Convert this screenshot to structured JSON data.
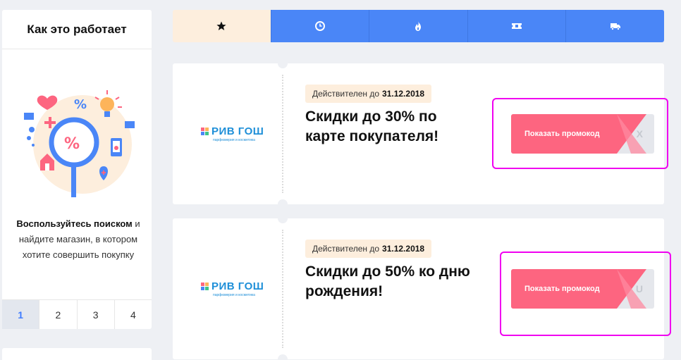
{
  "sidebar": {
    "title": "Как это работает",
    "text_bold": "Воспользуйтесь поиском",
    "text_rest": " и найдите магазин, в котором хотите совершить покупку",
    "steps": [
      "1",
      "2",
      "3",
      "4"
    ],
    "active_step": "1"
  },
  "tabs": [
    {
      "icon": "star-icon",
      "active": true
    },
    {
      "icon": "clock-icon",
      "active": false
    },
    {
      "icon": "fire-icon",
      "active": false
    },
    {
      "icon": "ticket-icon",
      "active": false
    },
    {
      "icon": "truck-icon",
      "active": false
    }
  ],
  "coupons": [
    {
      "store_name": "РИВ ГОШ",
      "store_sub": "парфюмерия и косметика",
      "valid_label": "Действителен до",
      "valid_date": "31.12.2018",
      "title": "Скидки до 30% по карте покупателя!",
      "button_label": "Показать промокод",
      "code_tail": "X"
    },
    {
      "store_name": "РИВ ГОШ",
      "store_sub": "парфюмерия и косметика",
      "valid_label": "Действителен до",
      "valid_date": "31.12.2018",
      "title": "Скидки до 50% ко дню рождения!",
      "button_label": "Показать промокод",
      "code_tail": "U"
    }
  ],
  "colors": {
    "accent_blue": "#4a86f7",
    "promo_pink": "#fd6580",
    "tab_active_bg": "#fdeedd",
    "highlight": "#f000f0"
  }
}
